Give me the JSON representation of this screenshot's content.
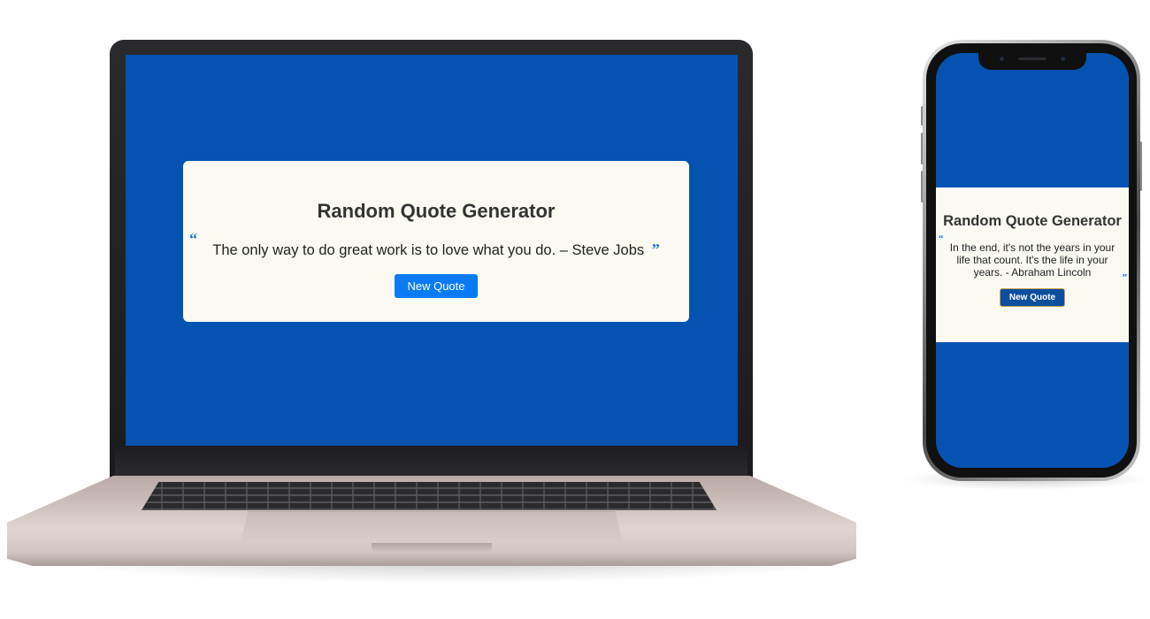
{
  "laptop": {
    "app": {
      "title": "Random Quote Generator",
      "quote": "The only way to do great work is to love what you do. – Steve Jobs",
      "open_quote_mark": "“",
      "close_quote_mark": "”",
      "button_label": "New Quote"
    }
  },
  "phone": {
    "app": {
      "title": "Random Quote Generator",
      "quote": "In the end, it's not the years in your life that count. It's the life in your years. - Abraham Lincoln",
      "open_quote_mark": "“",
      "close_quote_mark": "”",
      "button_label": "New Quote"
    }
  },
  "colors": {
    "background_blue": "#0453b1",
    "card_bg": "#fafaf3",
    "laptop_button": "#0a7bf5",
    "phone_button": "#0b4f9e",
    "quote_mark": "#1b72d9"
  }
}
